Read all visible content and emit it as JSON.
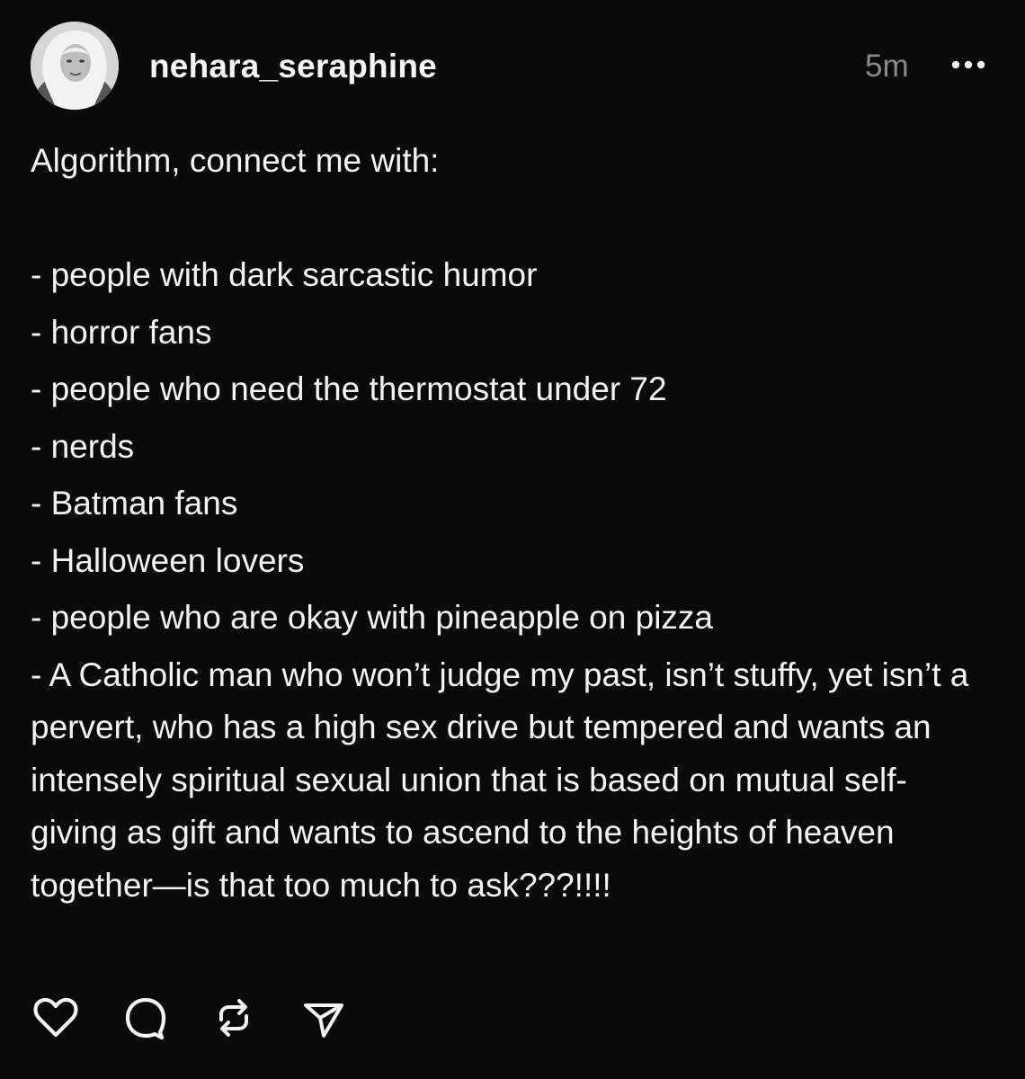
{
  "post": {
    "username": "nehara_seraphine",
    "time": "5m",
    "avatar_icon": "user-avatar-photo",
    "more_icon": "more-horizontal-icon",
    "intro": "Algorithm, connect me with:",
    "list": [
      "- people with dark sarcastic humor",
      "- horror fans",
      "- people who need the thermostat under 72",
      "- nerds",
      "- Batman fans",
      "- Halloween lovers",
      "- people who are okay with pineapple on pizza"
    ],
    "final_item": "- A Catholic man who won’t judge my past, isn’t stuffy, yet isn’t a pervert, who has a high sex drive but tempered and wants an intensely spiritual sexual union that is based on mutual self-giving as gift and wants to ascend to the heights of heaven together—is that too much to ask???!!!!"
  },
  "actions": [
    {
      "name": "like-button",
      "icon": "heart-icon"
    },
    {
      "name": "reply-button",
      "icon": "comment-bubble-icon"
    },
    {
      "name": "repost-button",
      "icon": "repost-icon"
    },
    {
      "name": "share-button",
      "icon": "send-icon"
    }
  ],
  "colors": {
    "background": "#0a0a0a",
    "text": "#f3f3f3",
    "muted": "#8a8a8a"
  }
}
